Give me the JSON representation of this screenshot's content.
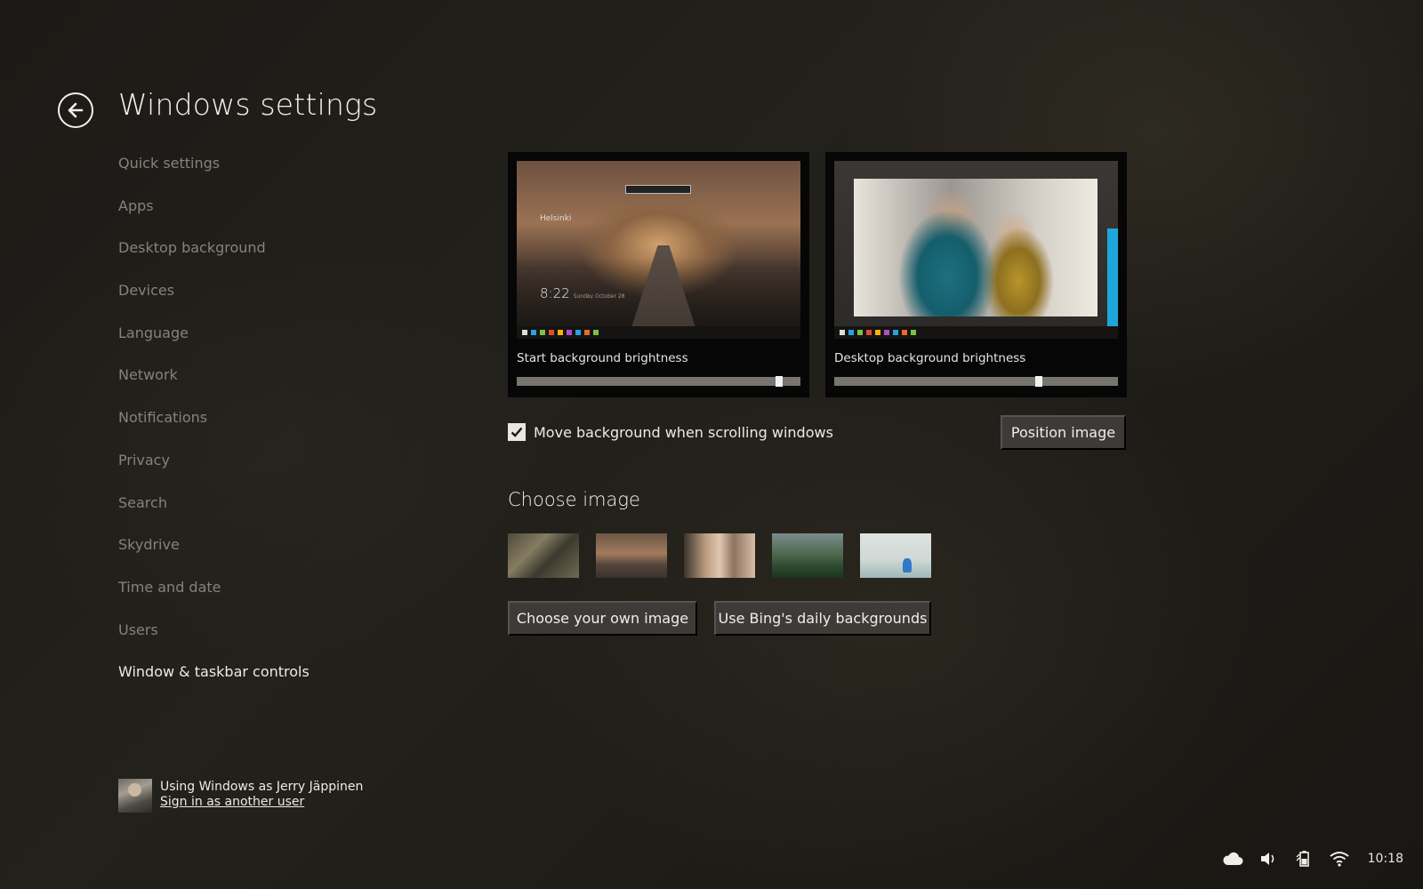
{
  "header": {
    "title": "Windows settings"
  },
  "sidebar": {
    "items": [
      {
        "label": "Quick settings"
      },
      {
        "label": "Apps"
      },
      {
        "label": "Desktop background"
      },
      {
        "label": "Devices"
      },
      {
        "label": "Language"
      },
      {
        "label": "Network"
      },
      {
        "label": "Notifications"
      },
      {
        "label": "Privacy"
      },
      {
        "label": "Search"
      },
      {
        "label": "Skydrive"
      },
      {
        "label": "Time and date"
      },
      {
        "label": "Users"
      },
      {
        "label": "Window & taskbar controls",
        "active": true
      }
    ]
  },
  "user": {
    "using_text": "Using Windows as Jerry Jäppinen",
    "signin_link": "Sign in as another user"
  },
  "previews": {
    "start": {
      "label": "Start background brightness",
      "brightness": 0.925,
      "mini_city": "Helsinki",
      "mini_time": "8:22",
      "mini_date": "Sunday October 28"
    },
    "desktop": {
      "label": "Desktop background brightness",
      "brightness": 0.72
    }
  },
  "options": {
    "move_background_label": "Move background when scrolling windows",
    "move_background_checked": true,
    "position_image_button": "Position image"
  },
  "choose_image": {
    "title": "Choose image",
    "thumbnails": [
      "forest-branches",
      "evening-street",
      "people-kitchen",
      "green-mountain",
      "pale-sea-bird"
    ],
    "choose_own_button": "Choose your own image",
    "bing_button": "Use Bing's daily backgrounds"
  },
  "tray": {
    "icons": [
      "cloud-icon",
      "speaker-icon",
      "battery-icon",
      "wifi-icon"
    ],
    "time": "10:18"
  }
}
